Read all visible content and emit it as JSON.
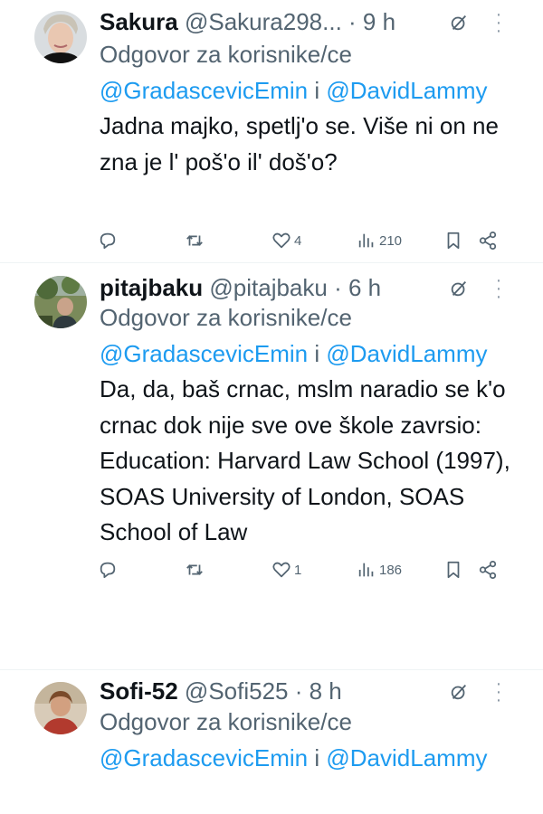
{
  "tweets": [
    {
      "name": "Sakura",
      "handle": "@Sakura298...",
      "sep": " · ",
      "time": "9 h",
      "reply_prefix": "Odgovor za korisnike/ce ",
      "mention1": "@GradascevicEmin",
      "joiner": " i ",
      "mention2": "@DavidLammy",
      "text": "Jadna majko, spetlj'o se. Više ni on ne zna je l' poš'o il' doš'o?",
      "likes": "4",
      "views": "210"
    },
    {
      "name": "pitajbaku",
      "handle": "@pitajbaku",
      "sep": " · ",
      "time": "6 h",
      "reply_prefix": "Odgovor za korisnike/ce ",
      "mention1": "@GradascevicEmin",
      "joiner": " i ",
      "mention2": "@DavidLammy",
      "text": "Da, da, baš crnac,  mslm naradio se k'o crnac dok nije sve ove škole zavrsio:\nEducation: Harvard Law School (1997), SOAS University of London, SOAS School of Law",
      "likes": "1",
      "views": "186"
    },
    {
      "name": "Sofi-52",
      "handle": "@Sofi525",
      "sep": " · ",
      "time": "8 h",
      "reply_prefix": "Odgovor za korisnike/ce ",
      "mention1": "@GradascevicEmin",
      "joiner": " i ",
      "mention2": "@DavidLammy"
    }
  ],
  "icons": {
    "reply": "reply-icon",
    "retweet": "retweet-icon",
    "like": "heart-icon",
    "views": "views-icon",
    "bookmark": "bookmark-icon",
    "share": "share-icon",
    "grok": "grok-icon",
    "more": "more-icon"
  },
  "colors": {
    "mention": "#1d9bf0",
    "secondary_text": "#536471",
    "primary_text": "#0f1419"
  }
}
